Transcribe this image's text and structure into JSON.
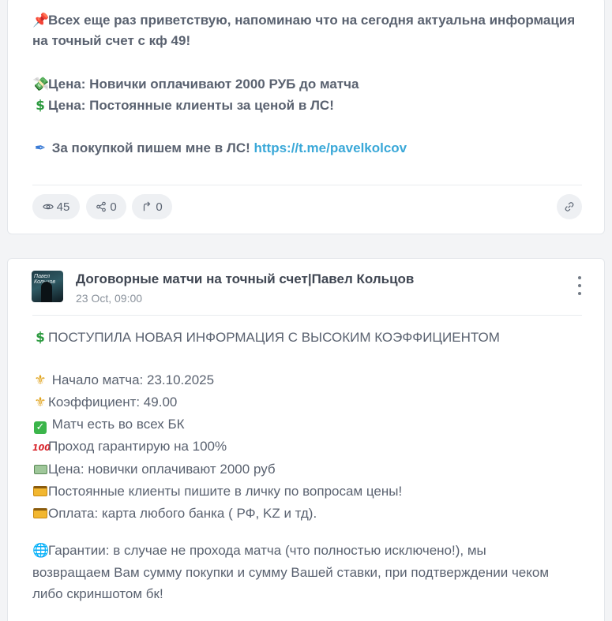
{
  "post1": {
    "line1": "Всех еще раз приветствую, напоминаю что на сегодня актуальна информация",
    "line2": "на точный счет с кф 49!",
    "price_new": "Цена: Новички оплачивают 2000 РУБ до матча",
    "price_regular": "Цена: Постоянные клиенты за ценой в ЛС!",
    "purchase": " За покупкой пишем мне в ЛС! ",
    "link": "https://t.me/pavelkolcov",
    "views": "45",
    "shares": "0",
    "forwards": "0"
  },
  "post2": {
    "channel_name": "Договорные матчи на точный счет|Павел Кольцов",
    "date": "23 Oct, 09:00",
    "avatar_text_1": "Павел",
    "avatar_text_2": "Кольцов",
    "headline": "ПОСТУПИЛА НОВАЯ ИНФОРМАЦИЯ С ВЫСОКИМ КОЭФФИЦИЕНТОМ",
    "start": " Начало матча: 23.10.2025",
    "coef": "Коэффициент: 49.00",
    "all_bk": " Матч есть во всех БК",
    "guarantee": "Проход гарантирую на 100%",
    "price": "Цена: новички оплачивают 2000 руб",
    "regular": "Постоянные клиенты пишите в личку по вопросам цены!",
    "payment": "Оплата: карта любого банка ( РФ, KZ и тд).",
    "warranty_1": "Гарантии: в случае не прохода матча (что полностью исключено!), мы",
    "warranty_2": "возвращаем Вам сумму покупки и сумму Вашей ставки, при подтверждении чеком",
    "warranty_3": "либо скриншотом бк!"
  },
  "icons": {
    "pin": "pushpin-icon",
    "money_wings": "money-with-wings-icon",
    "dollar": "heavy-dollar-sign-icon",
    "pen": "pen-icon",
    "fleur": "fleur-de-lis-icon",
    "check": "check-mark-button-icon",
    "hundred": "hundred-points-icon",
    "banknote": "banknote-icon",
    "card": "credit-card-icon",
    "globe": "globe-icon",
    "eye": "eye-icon",
    "share": "share-icon",
    "forward": "forward-icon",
    "link": "link-icon",
    "more": "more-vertical-icon"
  },
  "colors": {
    "link": "#3aa8d8",
    "text": "#5a6270",
    "pill_bg": "#eef0f3"
  }
}
